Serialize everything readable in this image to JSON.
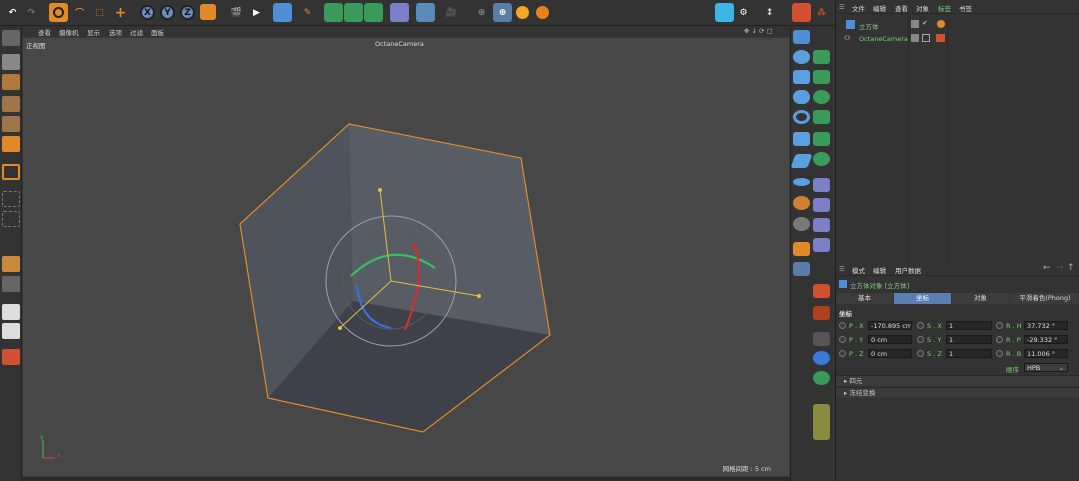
{
  "toolbar": {
    "axis_x": "X",
    "axis_y": "Y",
    "axis_z": "Z"
  },
  "viewport": {
    "menu": [
      "查看",
      "摄像机",
      "显示",
      "选项",
      "过滤",
      "面板"
    ],
    "view_name": "正视图",
    "camera_name": "OctaneCamera",
    "grid_spacing": "网格间距 : 5 cm",
    "axis_x": "x",
    "axis_y": "y"
  },
  "object_manager": {
    "menu": [
      "文件",
      "编辑",
      "查看",
      "对象",
      "标签",
      "书签"
    ],
    "objects": [
      {
        "name": "立方体",
        "color": "#7fd07f"
      },
      {
        "name": "OctaneCamera",
        "color": "#7fd07f"
      }
    ]
  },
  "attributes": {
    "menu": [
      "模式",
      "编辑",
      "用户数据"
    ],
    "object_title": "立方体对象 [立方体]",
    "tabs": [
      "基本",
      "坐标",
      "对象",
      "平滑着色(Phong)"
    ],
    "active_tab": "坐标",
    "section_title": "坐标",
    "fields": {
      "px_label": "P . X",
      "px_value": "-170.895 cm",
      "py_label": "P . Y",
      "py_value": "0 cm",
      "pz_label": "P . Z",
      "pz_value": "0 cm",
      "sx_label": "S . X",
      "sx_value": "1",
      "sy_label": "S . Y",
      "sy_value": "1",
      "sz_label": "S . Z",
      "sz_value": "1",
      "rh_label": "R . H",
      "rh_value": "37.732 °",
      "rp_label": "R . P",
      "rp_value": "-29.332 °",
      "rb_label": "R . B",
      "rb_value": "11.006 °",
      "order_label": "顺序",
      "order_value": "HPB"
    },
    "sections": [
      "四元",
      "冻结变换"
    ]
  },
  "colors": {
    "accent": "#5b7fb0",
    "selection_orange": "#e08a2a",
    "green_label": "#7fd07f"
  }
}
